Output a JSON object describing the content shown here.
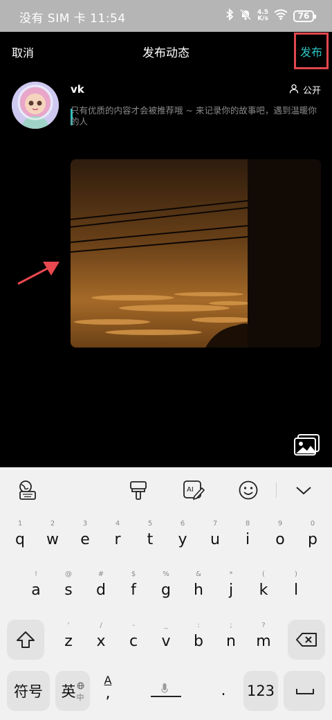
{
  "status_bar": {
    "carrier_time": "没有 SIM 卡 11:54",
    "net_speed_value": "4.5",
    "net_speed_unit": "K/s",
    "battery": "76",
    "icons": [
      "bluetooth-icon",
      "mute-icon",
      "wifi-icon",
      "battery-icon"
    ]
  },
  "header": {
    "cancel": "取消",
    "title": "发布动态",
    "publish": "发布"
  },
  "composer": {
    "username": "vk",
    "visibility": "公开",
    "placeholder": "只有优质的内容才会被推荐哦 ~ 来记录你的故事吧，遇到温暖你的人"
  },
  "keyboard": {
    "toolbar_icons": [
      "globe-keyboard-icon",
      "brush-icon",
      "ai-edit-icon",
      "emoji-icon",
      "chevron-down-icon"
    ],
    "row1": [
      {
        "hint": "1",
        "letter": "q"
      },
      {
        "hint": "2",
        "letter": "w"
      },
      {
        "hint": "3",
        "letter": "e"
      },
      {
        "hint": "4",
        "letter": "r"
      },
      {
        "hint": "5",
        "letter": "t"
      },
      {
        "hint": "6",
        "letter": "y"
      },
      {
        "hint": "7",
        "letter": "u"
      },
      {
        "hint": "8",
        "letter": "i"
      },
      {
        "hint": "9",
        "letter": "o"
      },
      {
        "hint": "0",
        "letter": "p"
      }
    ],
    "row2": [
      {
        "hint": "!",
        "letter": "a"
      },
      {
        "hint": "@",
        "letter": "s"
      },
      {
        "hint": "#",
        "letter": "d"
      },
      {
        "hint": "$",
        "letter": "f"
      },
      {
        "hint": "%",
        "letter": "g"
      },
      {
        "hint": "&",
        "letter": "h"
      },
      {
        "hint": "*",
        "letter": "j"
      },
      {
        "hint": "(",
        "letter": "k"
      },
      {
        "hint": ")",
        "letter": "l"
      }
    ],
    "row3": [
      {
        "hint": "'",
        "letter": "z"
      },
      {
        "hint": "/",
        "letter": "x"
      },
      {
        "hint": "-",
        "letter": "c"
      },
      {
        "hint": "_",
        "letter": "v"
      },
      {
        "hint": ":",
        "letter": "b"
      },
      {
        "hint": ";",
        "letter": "n"
      },
      {
        "hint": "?",
        "letter": "m"
      }
    ],
    "symbols": "符号",
    "lang_main": "英",
    "lang_alt": "中",
    "caps_top": "A",
    "caps_bottom": ",",
    "period": ".",
    "numbers": "123"
  },
  "colors": {
    "accent": "#2ec3c3",
    "highlight_box": "#e2474f",
    "arrow": "#e8484f",
    "keyboard_bg": "#f1f1f1"
  }
}
